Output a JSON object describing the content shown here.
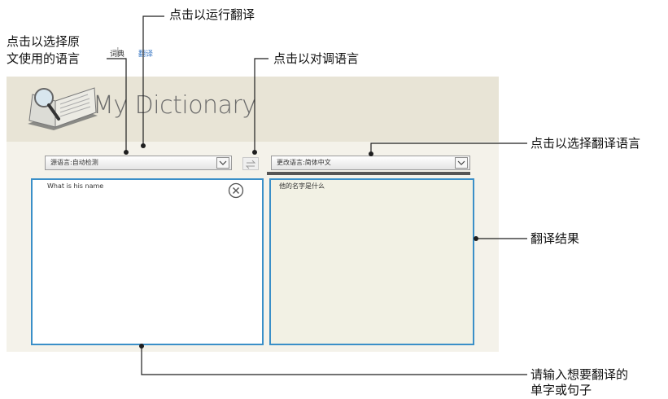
{
  "app": {
    "title": "My Dictionary",
    "nav": {
      "dictionary": "词典",
      "translate": "翻译"
    }
  },
  "source_language": {
    "label": "源语言:自动检测"
  },
  "target_language": {
    "label": "更改语言:简体中文"
  },
  "source_text": "What is his name",
  "translation_text": "他的名字是什么",
  "callouts": {
    "run_translate": "点击以运行翻译",
    "select_source_line1": "点击以选择原",
    "select_source_line2": "文使用的语言",
    "swap": "点击以对调语言",
    "select_target": "点击以选择翻译语言",
    "result": "翻译结果",
    "input_line1": "请输入想要翻译的",
    "input_line2": "单字或句子"
  },
  "colors": {
    "callout_line": "#1f1f1f",
    "pane_border": "#3a8fc8",
    "nav_active": "#3a78c4"
  },
  "icons": {
    "logo": "book-magnifier-icon",
    "clear": "close-circle-icon",
    "swap": "swap-arrows-icon",
    "dropdown": "chevron-down-icon"
  }
}
